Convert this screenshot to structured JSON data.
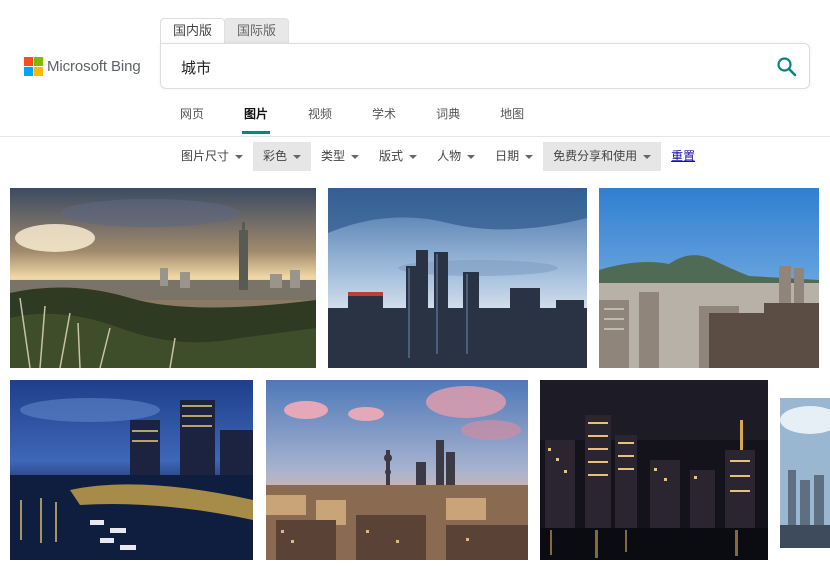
{
  "logo": {
    "text": "Microsoft Bing"
  },
  "edition_tabs": [
    {
      "label": "国内版",
      "active": true
    },
    {
      "label": "国际版",
      "active": false
    }
  ],
  "search": {
    "query": "城市"
  },
  "scope_nav": [
    {
      "label": "网页",
      "active": false
    },
    {
      "label": "图片",
      "active": true
    },
    {
      "label": "视频",
      "active": false
    },
    {
      "label": "学术",
      "active": false
    },
    {
      "label": "词典",
      "active": false
    },
    {
      "label": "地图",
      "active": false
    }
  ],
  "filters": [
    {
      "label": "图片尺寸",
      "active": false
    },
    {
      "label": "彩色",
      "active": true
    },
    {
      "label": "类型",
      "active": false
    },
    {
      "label": "版式",
      "active": false
    },
    {
      "label": "人物",
      "active": false
    },
    {
      "label": "日期",
      "active": false
    },
    {
      "label": "免费分享和使用",
      "active": true
    }
  ],
  "reset_label": "重置",
  "colors": {
    "accent": "#0c8484",
    "link": "#1a0dab",
    "ms_red": "#f25022",
    "ms_green": "#7fba00",
    "ms_blue": "#00a4ef",
    "ms_yellow": "#ffb900"
  },
  "images": [
    {
      "subject": "sunset city skyline with tower"
    },
    {
      "subject": "modern skyscrapers blue sky"
    },
    {
      "subject": "city with mountain backdrop"
    },
    {
      "subject": "waterfront marina at dusk"
    },
    {
      "subject": "skyline with TV tower at dusk"
    },
    {
      "subject": "night skyline over river"
    },
    {
      "subject": "partial city skyline"
    }
  ]
}
